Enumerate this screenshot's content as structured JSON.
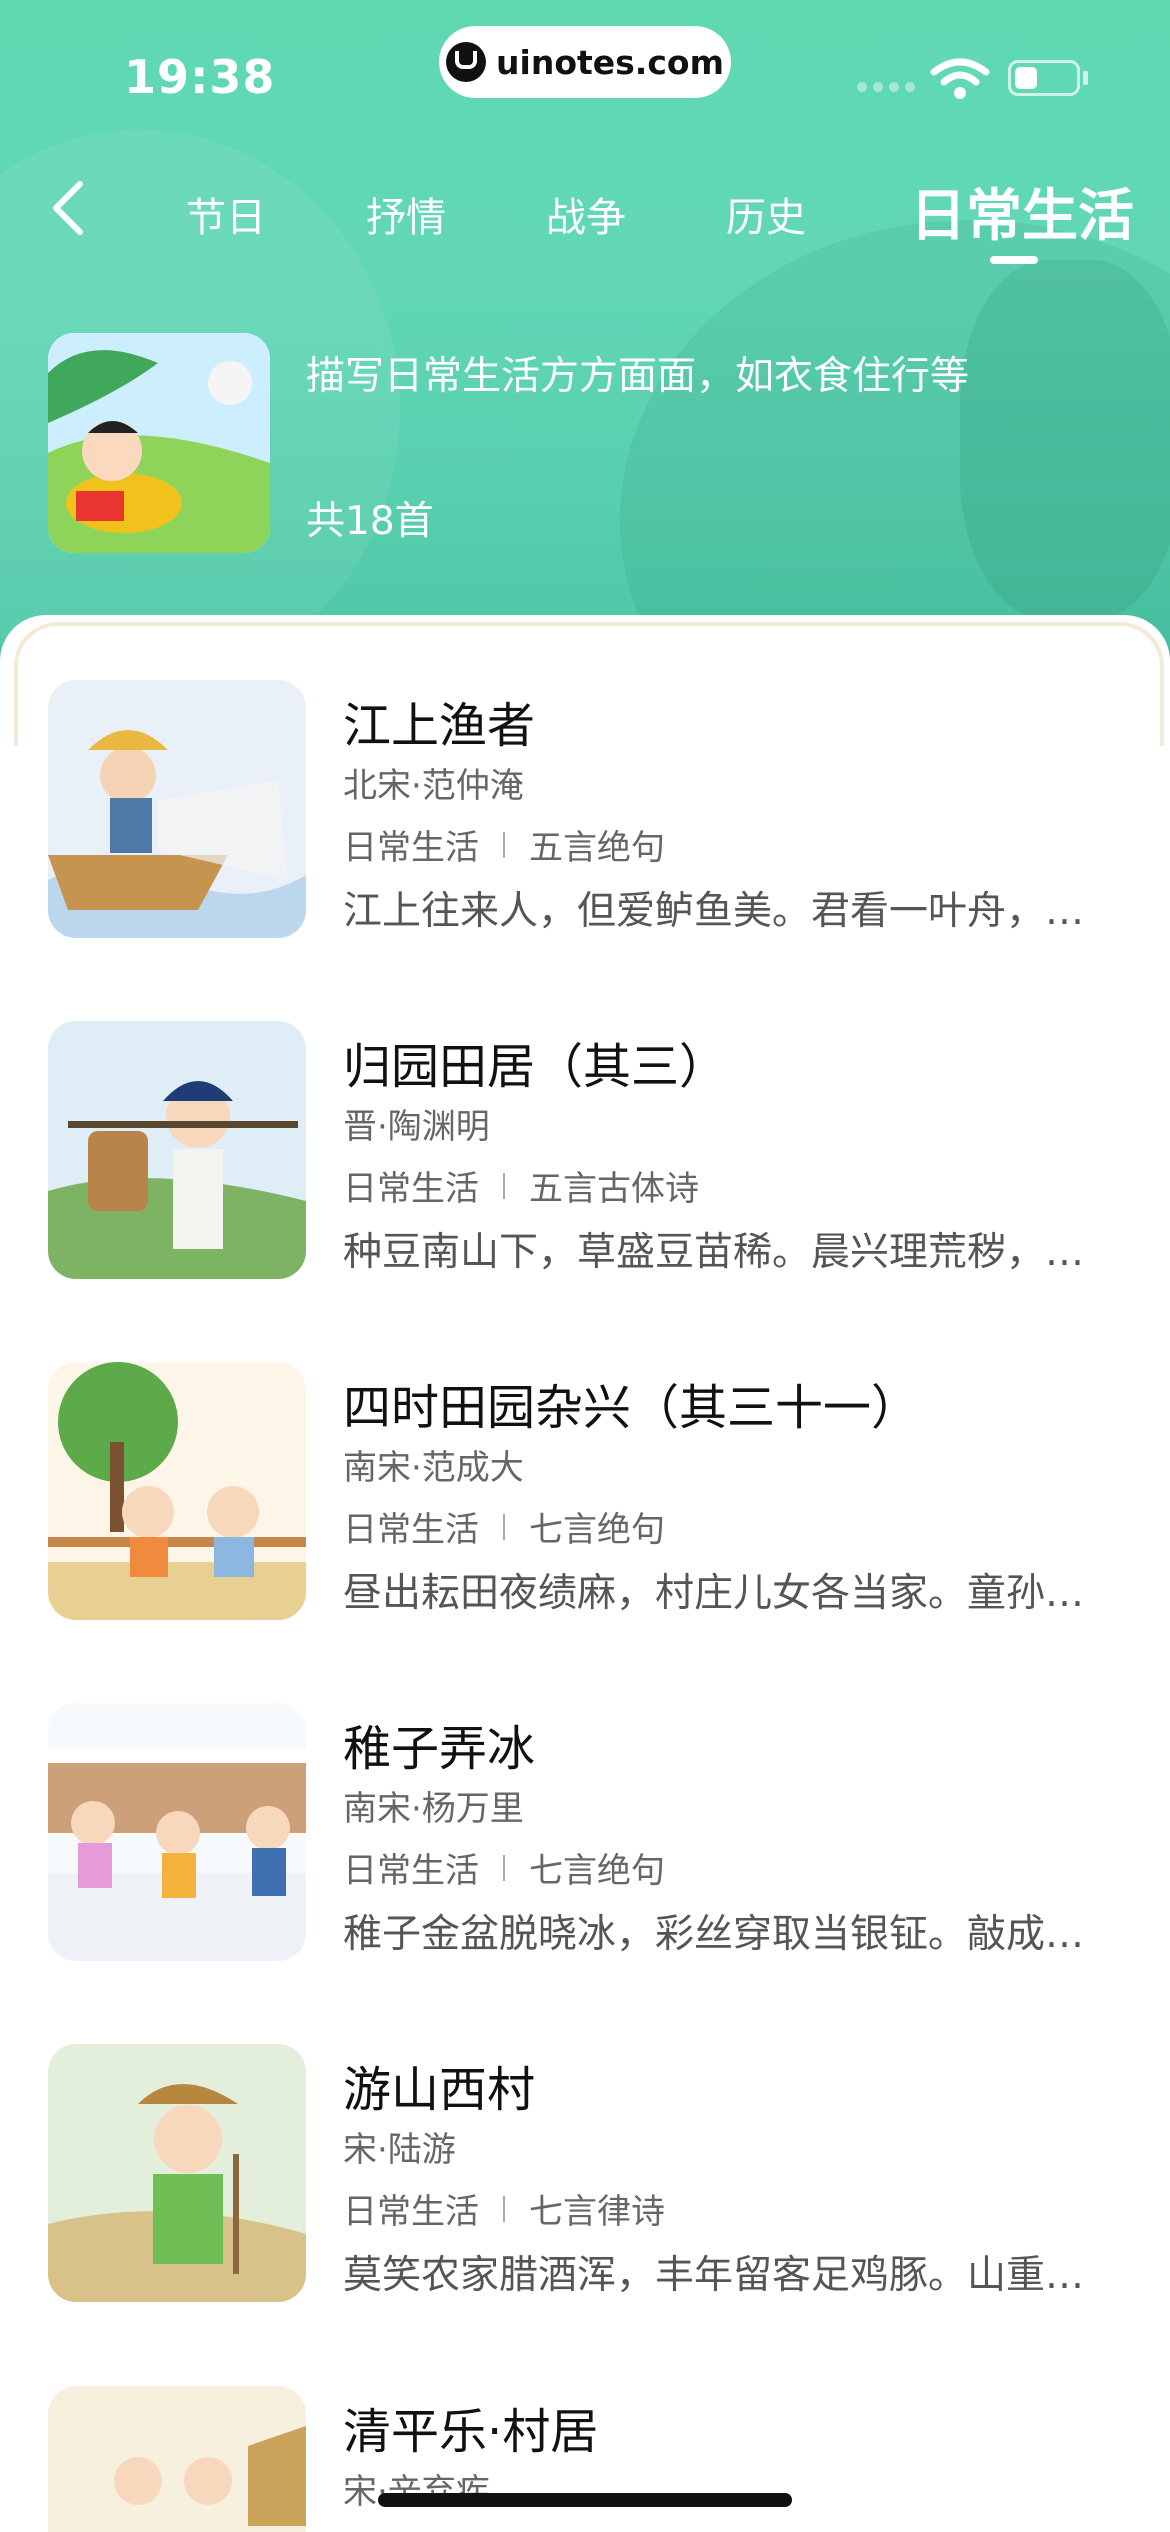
{
  "status": {
    "time": "19:38",
    "url": "uinotes.com"
  },
  "tabs": [
    {
      "label": "节日",
      "active": false
    },
    {
      "label": "抒情",
      "active": false
    },
    {
      "label": "战争",
      "active": false
    },
    {
      "label": "历史",
      "active": false
    },
    {
      "label": "日常生活",
      "active": true
    }
  ],
  "category": {
    "description": "描写日常生活方方面面，如衣食住行等",
    "count": "共18首"
  },
  "poems": [
    {
      "title": "江上渔者",
      "author": "北宋·范仲淹",
      "theme": "日常生活",
      "form": "五言绝句",
      "excerpt": "江上往来人，但爱鲈鱼美。君看一叶舟，出没风波里。"
    },
    {
      "title": "归园田居（其三）",
      "author": "晋·陶渊明",
      "theme": "日常生活",
      "form": "五言古体诗",
      "excerpt": "种豆南山下，草盛豆苗稀。晨兴理荒秽，带月荷锄归。"
    },
    {
      "title": "四时田园杂兴（其三十一）",
      "author": "南宋·范成大",
      "theme": "日常生活",
      "form": "七言绝句",
      "excerpt": "昼出耘田夜绩麻，村庄儿女各当家。童孙未解供耕织，也傍桑阴学种瓜。"
    },
    {
      "title": "稚子弄冰",
      "author": "南宋·杨万里",
      "theme": "日常生活",
      "form": "七言绝句",
      "excerpt": "稚子金盆脱晓冰，彩丝穿取当银钲。敲成玉磬穿林响，忽作玻璃碎地声。"
    },
    {
      "title": "游山西村",
      "author": "宋·陆游",
      "theme": "日常生活",
      "form": "七言律诗",
      "excerpt": "莫笑农家腊酒浑，丰年留客足鸡豚。山重水复疑无路，柳暗花明又一村。"
    },
    {
      "title": "清平乐·村居",
      "author": "宋·辛弃疾",
      "theme": "",
      "form": "",
      "excerpt": ""
    }
  ]
}
